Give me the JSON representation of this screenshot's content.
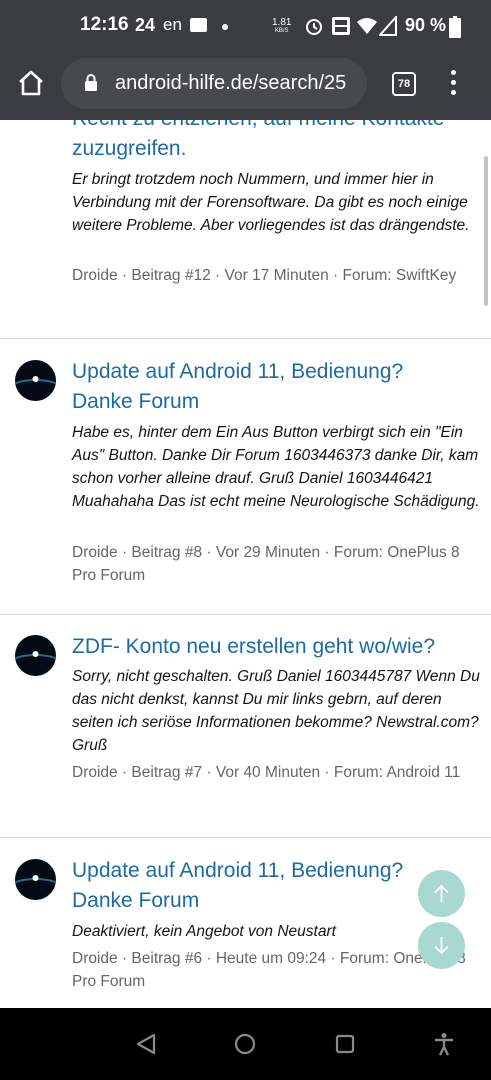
{
  "status_bar": {
    "time": "12:16",
    "date": "24",
    "lang": "en",
    "speed_value": "1.81",
    "speed_unit": "KB/S",
    "battery": "90 %",
    "icons": [
      "folder-icon",
      "dot-icon",
      "alarm-icon",
      "volte-icon",
      "wifi-icon",
      "signal-icon",
      "battery-icon"
    ]
  },
  "browser": {
    "url": "android-hilfe.de/search/25",
    "tab_count": "78"
  },
  "posts": [
    {
      "title": "Recht zu entziehen, auf meine Kontakte zuzugreifen.",
      "snippet": "Er bringt trotzdem noch Nummern, und immer hier in Verbindung mit der Forensoftware. Da gibt es noch einige weitere Probleme. Aber vorliegendes ist das drängendste.",
      "meta": "Droide · Beitrag #12 · Vor 17 Minuten · Forum: SwiftKey"
    },
    {
      "title": "Update auf Android 11, Bedienung? Danke Forum",
      "snippet": "Habe es, hinter dem Ein Aus Button verbirgt sich ein \"Ein Aus\" Button. Danke Dir Forum 1603446373 danke Dir, kam schon vorher alleine drauf. Gruß Daniel 1603446421 Muahahaha Das ist echt meine Neurologische Schädigung.",
      "meta": "Droide · Beitrag #8 · Vor 29 Minuten · Forum: OnePlus 8 Pro Forum"
    },
    {
      "title": "ZDF- Konto neu erstellen geht wo/wie?",
      "snippet": "Sorry, nicht geschalten. Gruß Daniel 1603445787 Wenn Du das nicht denkst, kannst Du mir links gebrn, auf deren seiten ich seriöse Informationen bekomme? Newstral.com? Gruß",
      "meta": "Droide · Beitrag #7 · Vor 40 Minuten · Forum: Android 11"
    },
    {
      "title": "Update auf Android 11, Bedienung? Danke Forum",
      "snippet": "Deaktiviert, kein Angebot von Neustart",
      "meta": "Droide · Beitrag #6 · Heute um 09:24 · Forum: OnePlus 8 Pro Forum"
    }
  ],
  "colors": {
    "title_link": "#1c6aa6",
    "chrome_bg": "#3b3c3f",
    "fab_bg": "#a9d8d3"
  }
}
